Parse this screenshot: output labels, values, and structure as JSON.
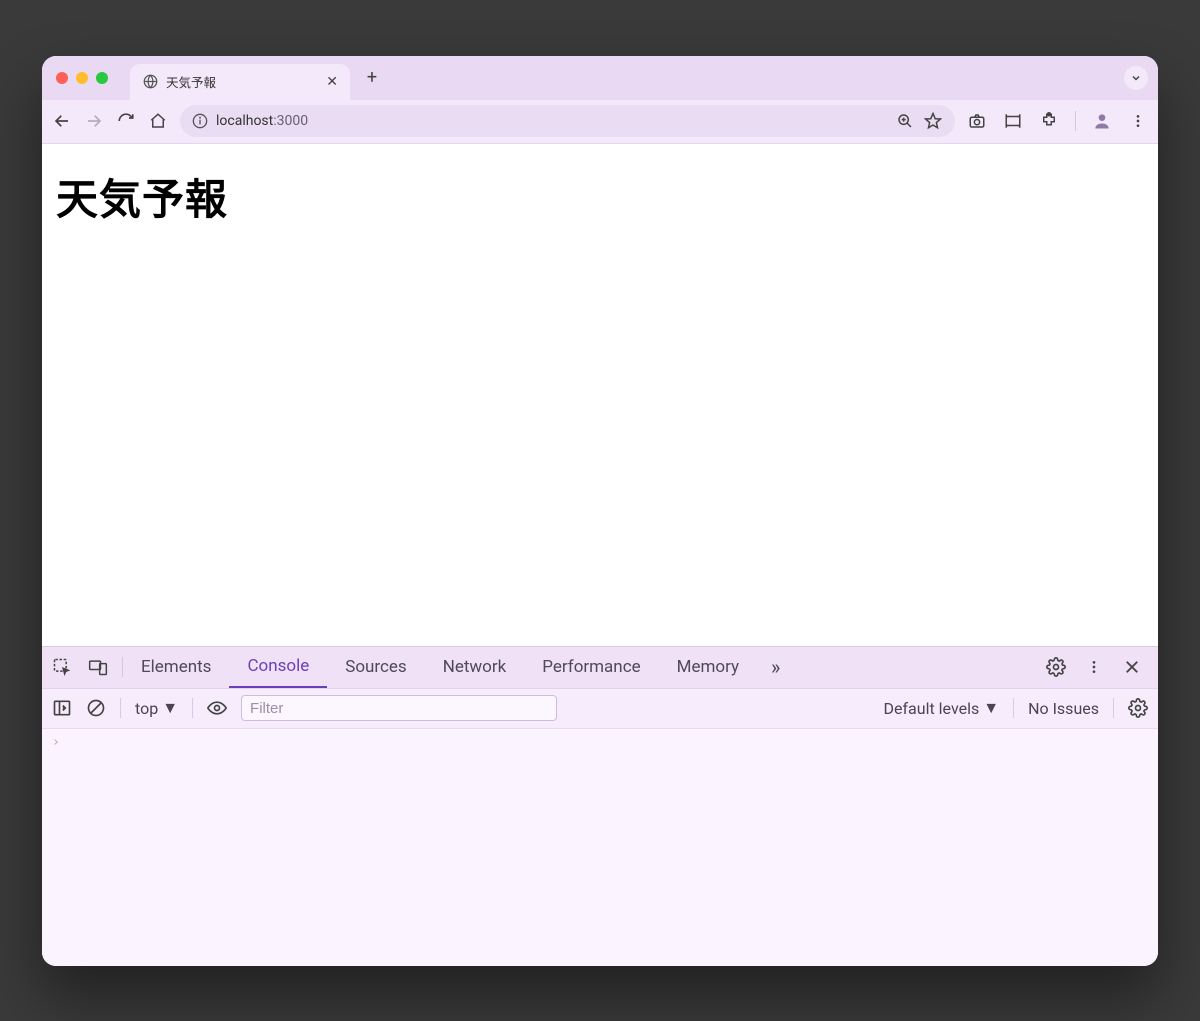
{
  "tab": {
    "title": "天気予報"
  },
  "address": {
    "host": "localhost",
    "port": ":3000"
  },
  "page": {
    "heading": "天気予報"
  },
  "devtools": {
    "tabs": [
      "Elements",
      "Console",
      "Sources",
      "Network",
      "Performance",
      "Memory"
    ],
    "active_index": 1,
    "context": "top",
    "filter_placeholder": "Filter",
    "levels_label": "Default levels",
    "issues_label": "No Issues",
    "prompt": "›"
  }
}
